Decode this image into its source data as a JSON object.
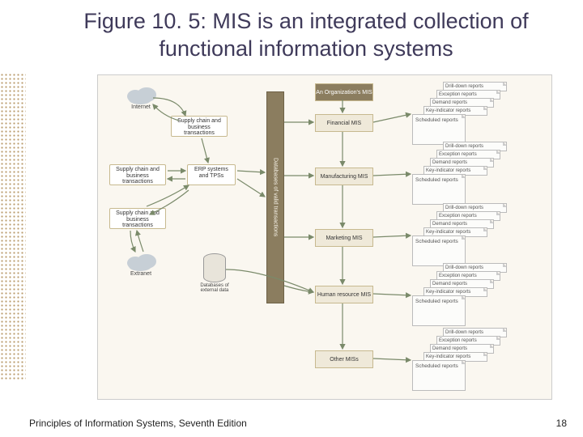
{
  "title": "Figure 10. 5: MIS is an integrated collection of functional information systems",
  "footer": "Principles of Information Systems, Seventh Edition",
  "page_number": "18",
  "clouds": {
    "internet": "Internet",
    "extranet": "Extranet"
  },
  "left_boxes": {
    "sc1": "Supply chain and business transactions",
    "sc2": "Supply chain and business transactions",
    "sc3": "Supply chain and business transactions",
    "erp": "ERP systems and TPSs"
  },
  "dbs": {
    "ext": "Databases of external data"
  },
  "vbar": "Databases of valid transactions",
  "mis": {
    "head": "An Organization's MIS",
    "fin": "Financial MIS",
    "mfg": "Manufacturing MIS",
    "mkt": "Marketing MIS",
    "hr": "Human resource MIS",
    "other": "Other MISs"
  },
  "reports": {
    "drill": "Drill-down reports",
    "exc": "Exception reports",
    "dem": "Demand reports",
    "key": "Key-indicator reports",
    "sched": "Scheduled reports"
  }
}
